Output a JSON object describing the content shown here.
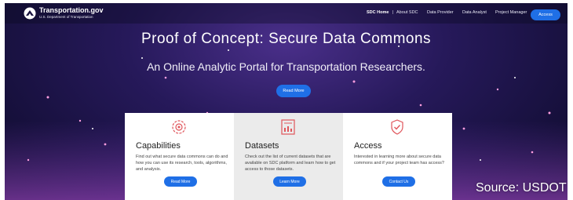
{
  "header": {
    "logo_title": "Transportation.gov",
    "logo_subtitle": "U.S. Department of Transportation",
    "nav": [
      {
        "label": "SDC Home"
      },
      {
        "label": "About SDC"
      },
      {
        "label": "Data Provider"
      },
      {
        "label": "Data Analyst"
      },
      {
        "label": "Project Manager"
      }
    ],
    "access_label": "Access"
  },
  "hero": {
    "title": "Proof of Concept: Secure Data Commons",
    "subtitle": "An Online Analytic Portal for Transportation Researchers.",
    "read_more_label": "Read More"
  },
  "cards": [
    {
      "icon": "gears-icon",
      "title": "Capabilities",
      "text": "Find out what secure data commons can do and how you can use its research, tools, algorithms, and analysis.",
      "button_label": "Read More"
    },
    {
      "icon": "dataset-chart-icon",
      "title": "Datasets",
      "text": "Check out the list of current datasets that are available on SDC platform and learn how to get access to those datasets.",
      "button_label": "Learn More"
    },
    {
      "icon": "shield-check-icon",
      "title": "Access",
      "text": "Interested in learning more about secure data commons and if your project team has access?",
      "button_label": "Contact Us"
    }
  ],
  "source_caption": "Source: USDOT",
  "colors": {
    "accent": "#1f6fe6",
    "card_icon": "#e0555b",
    "hero_bg": "#26195a"
  }
}
